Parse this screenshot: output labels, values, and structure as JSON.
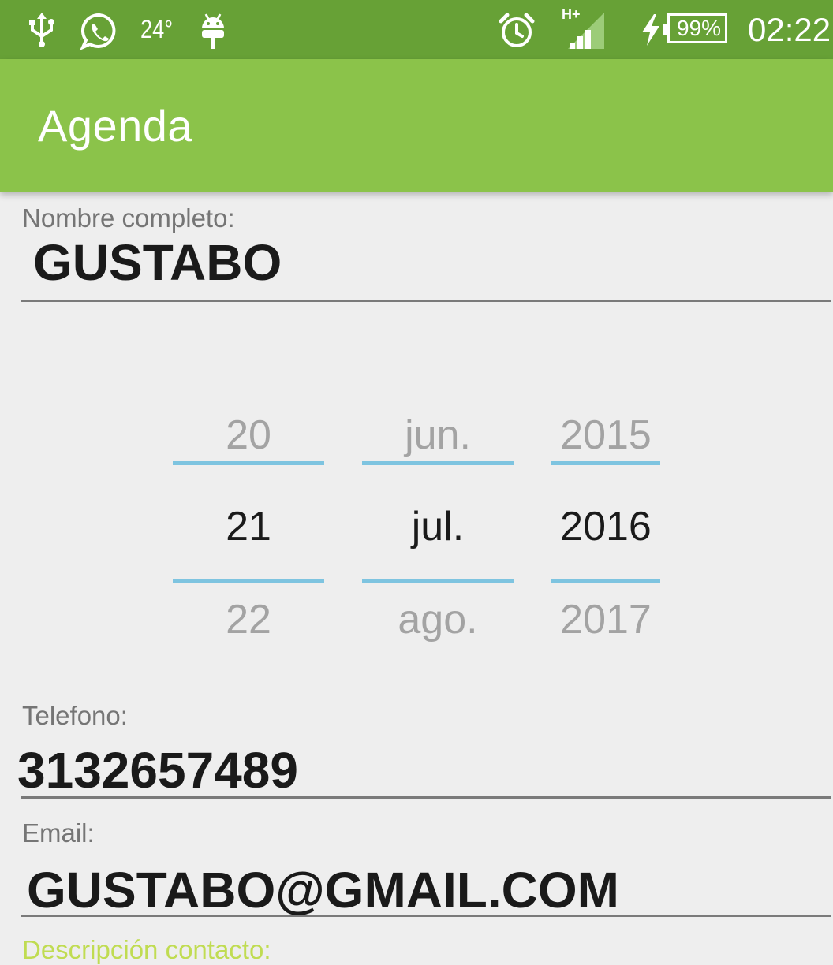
{
  "status_bar": {
    "temperature": "24°",
    "network_type": "H+",
    "battery": "99%",
    "time": "02:22",
    "background_color": "#67a136",
    "icons": [
      "usb-icon",
      "whatsapp-icon",
      "android-icon",
      "alarm-icon",
      "signal-icon",
      "charging-icon",
      "battery-icon"
    ]
  },
  "app_bar": {
    "title": "Agenda",
    "background_color": "#8bc34a"
  },
  "form": {
    "name": {
      "label": "Nombre completo:",
      "value": "GUSTABO"
    },
    "date_picker": {
      "day": {
        "prev": "20",
        "selected": "21",
        "next": "22"
      },
      "month": {
        "prev": "jun.",
        "selected": "jul.",
        "next": "ago."
      },
      "year": {
        "prev": "2015",
        "selected": "2016",
        "next": "2017"
      },
      "divider_color": "#7ec4e0"
    },
    "phone": {
      "label": "Telefono:",
      "value": "3132657489"
    },
    "email": {
      "label": "Email:",
      "value": "GUSTABO@GMAIL.COM"
    },
    "description": {
      "label": "Descripción contacto:",
      "accent_color": "#c0dc52"
    }
  }
}
